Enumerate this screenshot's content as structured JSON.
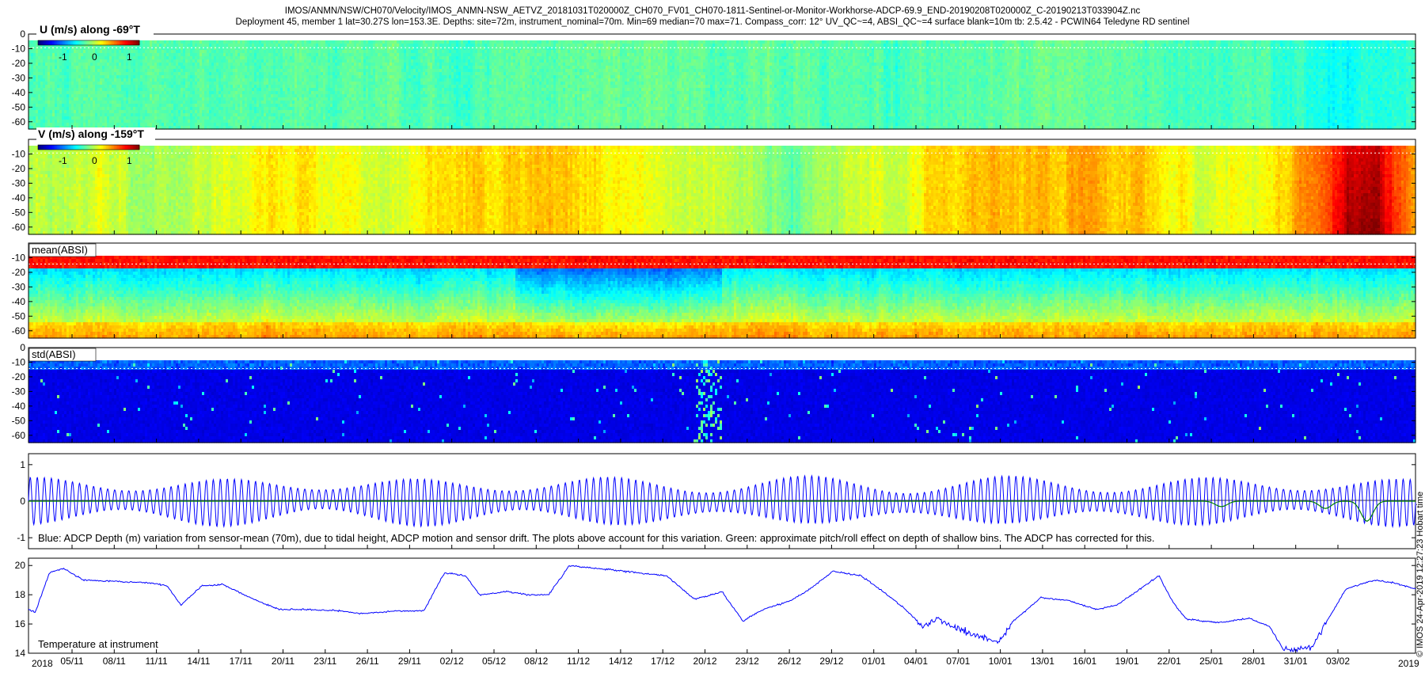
{
  "header": {
    "line1": "IMOS/ANMN/NSW/CH070/Velocity/IMOS_ANMN-NSW_AETVZ_20181031T020000Z_CH070_FV01_CH070-1811-Sentinel-or-Monitor-Workhorse-ADCP-69.9_END-20190208T020000Z_C-20190213T033904Z.nc",
    "line2": "Deployment 45, member 1 lat=30.27S lon=153.3E. Depths: site=72m, instrument_nominal=70m. Min=69 median=70 max=71. Compass_corr: 12° UV_QC~=4, ABSI_QC~=4 surface blank=10m tb: 2.5.42 - PCWIN64 Teledyne RD sentinel"
  },
  "side_note": "© IMOS 24-Apr-2019 12:27:23 Hobart time",
  "colors": {
    "blue_line": "#0000ff",
    "green_line": "#008000"
  },
  "panels": {
    "u": {
      "label": "U (m/s) along -69°T",
      "colorbar_ticks": [
        "-1",
        "0",
        "1"
      ]
    },
    "v": {
      "label": "V (m/s) along -159°T",
      "colorbar_ticks": [
        "-1",
        "0",
        "1"
      ]
    },
    "mean_absi": {
      "label": "mean(ABSI)"
    },
    "std_absi": {
      "label": "std(ABSI)"
    },
    "depth": {
      "caption": "Blue: ADCP Depth (m) variation from sensor-mean (70m), due to tidal height, ADCP motion and sensor drift. The plots above account for this variation. Green: approximate pitch/roll effect on depth of shallow bins. The ADCP has corrected for this."
    },
    "temp": {
      "caption": "Temperature at instrument"
    }
  },
  "chart_data": [
    {
      "type": "heatmap",
      "name": "U velocity",
      "title": "U (m/s) along -69°T",
      "ytick_labels": [
        "0",
        "-10",
        "-20",
        "-30",
        "-40",
        "-50",
        "-60"
      ],
      "ylim": [
        -65,
        0
      ],
      "colorbar": {
        "range": [
          -1.5,
          1.5
        ],
        "ticks": [
          "-1",
          "0",
          "1"
        ],
        "colormap": "jet"
      },
      "surface_blank_depth": -5,
      "profile": [
        {
          "t": 0,
          "v": -0.15
        },
        {
          "t": 0.1,
          "v": -0.1
        },
        {
          "t": 0.2,
          "v": -0.1
        },
        {
          "t": 0.3,
          "v": -0.15
        },
        {
          "t": 0.4,
          "v": -0.05
        },
        {
          "t": 0.5,
          "v": -0.1
        },
        {
          "t": 0.6,
          "v": -0.15
        },
        {
          "t": 0.7,
          "v": -0.1
        },
        {
          "t": 0.8,
          "v": -0.1
        },
        {
          "t": 0.9,
          "v": -0.2
        },
        {
          "t": 0.95,
          "v": -0.35
        },
        {
          "t": 1,
          "v": -0.2
        }
      ]
    },
    {
      "type": "heatmap",
      "name": "V velocity",
      "title": "V (m/s) along -159°T",
      "ytick_labels": [
        "-10",
        "-20",
        "-30",
        "-40",
        "-50",
        "-60"
      ],
      "ylim": [
        -65,
        0
      ],
      "colorbar": {
        "range": [
          -1.5,
          1.5
        ],
        "ticks": [
          "-1",
          "0",
          "1"
        ],
        "colormap": "jet"
      },
      "surface_blank_depth": -5,
      "profile": [
        {
          "t": 0,
          "v": 0.15
        },
        {
          "t": 0.05,
          "v": 0.3
        },
        {
          "t": 0.1,
          "v": 0.05
        },
        {
          "t": 0.15,
          "v": 0.35
        },
        {
          "t": 0.2,
          "v": 0.4
        },
        {
          "t": 0.25,
          "v": 0.25
        },
        {
          "t": 0.3,
          "v": 0.5
        },
        {
          "t": 0.35,
          "v": 0.55
        },
        {
          "t": 0.4,
          "v": 0.45
        },
        {
          "t": 0.45,
          "v": 0.3
        },
        {
          "t": 0.5,
          "v": 0.2
        },
        {
          "t": 0.55,
          "v": -0.1
        },
        {
          "t": 0.6,
          "v": 0.2
        },
        {
          "t": 0.65,
          "v": 0.4
        },
        {
          "t": 0.7,
          "v": 0.55
        },
        {
          "t": 0.75,
          "v": 0.6
        },
        {
          "t": 0.8,
          "v": 0.5
        },
        {
          "t": 0.85,
          "v": 0.3
        },
        {
          "t": 0.9,
          "v": 0.4
        },
        {
          "t": 0.94,
          "v": 0.9
        },
        {
          "t": 0.97,
          "v": 1.1
        },
        {
          "t": 1,
          "v": 0.6
        }
      ]
    },
    {
      "type": "heatmap",
      "name": "mean ABSI",
      "title": "mean(ABSI)",
      "ytick_labels": [
        "-10",
        "-20",
        "-30",
        "-40",
        "-50",
        "-60"
      ],
      "ylim": [
        -65,
        0
      ],
      "surface_blank_depth": -10
    },
    {
      "type": "heatmap",
      "name": "std ABSI",
      "title": "std(ABSI)",
      "ytick_labels": [
        "0",
        "-10",
        "-20",
        "-30",
        "-40",
        "-50",
        "-60"
      ],
      "ylim": [
        -65,
        0
      ],
      "surface_blank_depth": -10
    },
    {
      "type": "line",
      "name": "ADCP depth variation",
      "ytick_labels": [
        "1",
        "0",
        "-1"
      ],
      "ylim": [
        -1.3,
        1.3
      ],
      "tidal_amplitude": 0.65,
      "tidal_cycles": 197,
      "green_dips": [
        {
          "t": 0.86,
          "v": -0.15
        },
        {
          "t": 0.935,
          "v": -0.2
        },
        {
          "t": 0.965,
          "v": -0.55
        }
      ]
    },
    {
      "type": "line",
      "name": "Temperature at instrument",
      "ytick_labels": [
        "20",
        "18",
        "16",
        "14"
      ],
      "ylim": [
        14,
        20.5
      ],
      "series": [
        {
          "points": [
            {
              "t": 0,
              "v": 17.0
            },
            {
              "t": 0.005,
              "v": 16.8
            },
            {
              "t": 0.015,
              "v": 19.5
            },
            {
              "t": 0.025,
              "v": 19.8
            },
            {
              "t": 0.04,
              "v": 19.0
            },
            {
              "t": 0.065,
              "v": 18.9
            },
            {
              "t": 0.09,
              "v": 18.8
            },
            {
              "t": 0.1,
              "v": 18.6
            },
            {
              "t": 0.11,
              "v": 17.3
            },
            {
              "t": 0.125,
              "v": 18.6
            },
            {
              "t": 0.14,
              "v": 18.7
            },
            {
              "t": 0.16,
              "v": 17.8
            },
            {
              "t": 0.18,
              "v": 17.0
            },
            {
              "t": 0.2,
              "v": 17.0
            },
            {
              "t": 0.225,
              "v": 16.9
            },
            {
              "t": 0.24,
              "v": 16.7
            },
            {
              "t": 0.265,
              "v": 16.9
            },
            {
              "t": 0.285,
              "v": 16.9
            },
            {
              "t": 0.3,
              "v": 19.5
            },
            {
              "t": 0.315,
              "v": 19.3
            },
            {
              "t": 0.325,
              "v": 18.0
            },
            {
              "t": 0.345,
              "v": 18.2
            },
            {
              "t": 0.36,
              "v": 18.0
            },
            {
              "t": 0.375,
              "v": 18.0
            },
            {
              "t": 0.39,
              "v": 20.0
            },
            {
              "t": 0.41,
              "v": 19.8
            },
            {
              "t": 0.43,
              "v": 19.6
            },
            {
              "t": 0.46,
              "v": 19.3
            },
            {
              "t": 0.48,
              "v": 17.7
            },
            {
              "t": 0.5,
              "v": 18.2
            },
            {
              "t": 0.515,
              "v": 16.2
            },
            {
              "t": 0.53,
              "v": 17.0
            },
            {
              "t": 0.55,
              "v": 17.6
            },
            {
              "t": 0.565,
              "v": 18.5
            },
            {
              "t": 0.58,
              "v": 19.6
            },
            {
              "t": 0.6,
              "v": 19.3
            },
            {
              "t": 0.615,
              "v": 18.3
            },
            {
              "t": 0.63,
              "v": 17.2
            },
            {
              "t": 0.645,
              "v": 15.8
            },
            {
              "t": 0.655,
              "v": 16.4
            },
            {
              "t": 0.67,
              "v": 15.6
            },
            {
              "t": 0.685,
              "v": 15.2
            },
            {
              "t": 0.7,
              "v": 14.8
            },
            {
              "t": 0.71,
              "v": 16.2
            },
            {
              "t": 0.73,
              "v": 17.8
            },
            {
              "t": 0.75,
              "v": 17.6
            },
            {
              "t": 0.77,
              "v": 17.0
            },
            {
              "t": 0.785,
              "v": 17.3
            },
            {
              "t": 0.8,
              "v": 18.3
            },
            {
              "t": 0.815,
              "v": 19.3
            },
            {
              "t": 0.825,
              "v": 17.5
            },
            {
              "t": 0.835,
              "v": 16.3
            },
            {
              "t": 0.86,
              "v": 16.1
            },
            {
              "t": 0.88,
              "v": 16.4
            },
            {
              "t": 0.895,
              "v": 15.8
            },
            {
              "t": 0.905,
              "v": 14.2
            },
            {
              "t": 0.925,
              "v": 14.4
            },
            {
              "t": 0.935,
              "v": 16.0
            },
            {
              "t": 0.95,
              "v": 18.4
            },
            {
              "t": 0.97,
              "v": 19.0
            },
            {
              "t": 0.985,
              "v": 18.8
            },
            {
              "t": 1,
              "v": 18.4
            }
          ]
        }
      ]
    }
  ],
  "xaxis": {
    "tick_labels": [
      "05/11",
      "08/11",
      "11/11",
      "14/11",
      "17/11",
      "20/11",
      "23/11",
      "26/11",
      "29/11",
      "02/12",
      "05/12",
      "08/12",
      "11/12",
      "14/12",
      "17/12",
      "20/12",
      "23/12",
      "26/12",
      "29/12",
      "01/01",
      "04/01",
      "07/01",
      "10/01",
      "13/01",
      "16/01",
      "19/01",
      "22/01",
      "25/01",
      "28/01",
      "31/01",
      "03/02"
    ],
    "year_start": "2018",
    "year_end": "2019"
  }
}
